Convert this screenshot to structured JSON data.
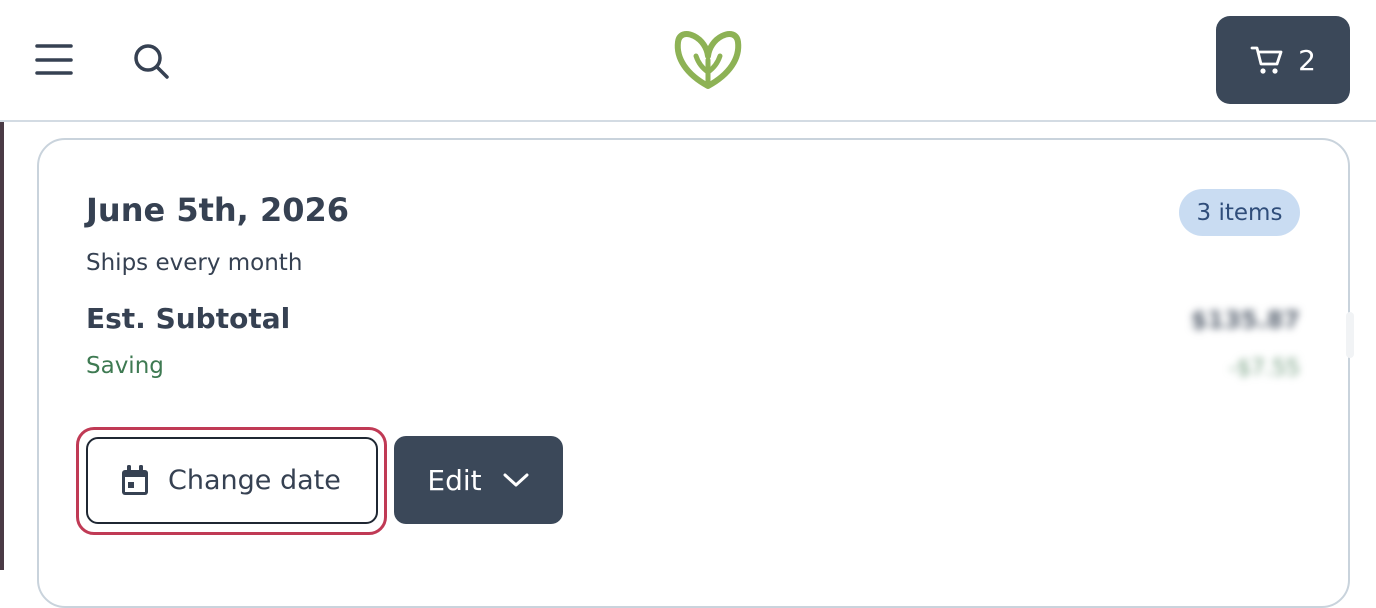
{
  "header": {
    "cart": {
      "count": "2"
    }
  },
  "icons": {
    "menu": "hamburger-menu-icon",
    "search": "search-icon",
    "logo": "leaf-heart-logo",
    "cart": "shopping-cart-icon",
    "calendar": "calendar-icon",
    "chevron": "chevron-down-icon"
  },
  "subscription": {
    "date": "June 5th, 2026",
    "items_badge": "3 items",
    "frequency": "Ships every month",
    "subtotal_label": "Est. Subtotal",
    "subtotal_value": "$135.87",
    "saving_label": "Saving",
    "saving_value": "-$7.55",
    "change_date_label": "Change date",
    "edit_label": "Edit"
  },
  "colors": {
    "primary_dark": "#3b4859",
    "logo_green": "#8db255",
    "saving_green": "#3e7a52",
    "badge_bg": "#c9dcf2",
    "focus_ring": "#c03a55"
  }
}
